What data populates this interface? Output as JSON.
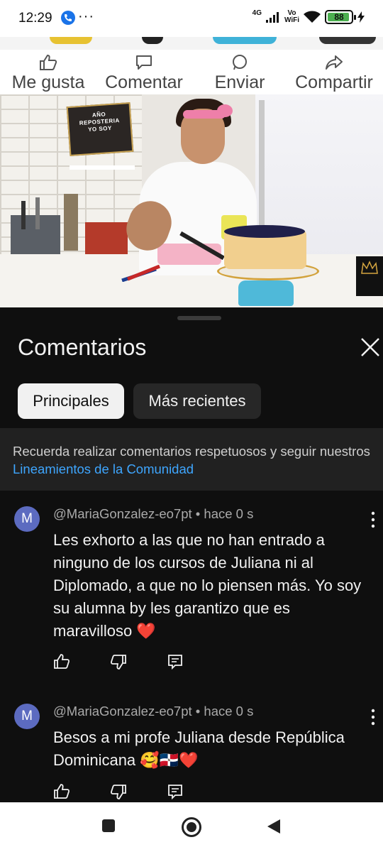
{
  "status_bar": {
    "time": "12:29",
    "dots": "···",
    "network": "4G",
    "volte_top": "Vo",
    "volte_bottom": "WiFi",
    "battery": "88"
  },
  "post_actions": [
    {
      "label": "Me gusta",
      "icon": "thumbs-up-icon"
    },
    {
      "label": "Comentar",
      "icon": "comment-bubble-icon"
    },
    {
      "label": "Enviar",
      "icon": "whatsapp-icon"
    },
    {
      "label": "Compartir",
      "icon": "share-arrow-icon"
    }
  ],
  "video": {
    "sign_lines": [
      "AÑO",
      "REPOSTERIA",
      "YO SOY"
    ]
  },
  "comments_panel": {
    "title": "Comentarios",
    "tabs": [
      {
        "label": "Principales",
        "active": true
      },
      {
        "label": "Más recientes",
        "active": false
      }
    ],
    "notice_text": "Recuerda realizar comentarios respetuosos y seguir nuestros ",
    "notice_link": "Lineamientos de la Comunidad"
  },
  "comments": [
    {
      "avatar_letter": "M",
      "author": "@MariaGonzalez-eo7pt",
      "time": "hace 0 s",
      "meta": "@MariaGonzalez-eo7pt • hace 0 s",
      "text": "Les exhorto a las que no han entrado a ninguno de los cursos de Juliana ni al Diplomado, a que no lo piensen más. Yo soy su alumna by les garantizo que es maravilloso ❤️"
    },
    {
      "avatar_letter": "M",
      "author": "@MariaGonzalez-eo7pt",
      "time": "hace 0 s",
      "meta": "@MariaGonzalez-eo7pt • hace 0 s",
      "text": "Besos a mi profe Juliana desde República Dominicana 🥰🇩🇴❤️"
    }
  ],
  "colors": {
    "accent_link": "#3ea6ff",
    "sheet_bg": "#0f0f0f",
    "avatar": "#5c6bc0"
  }
}
